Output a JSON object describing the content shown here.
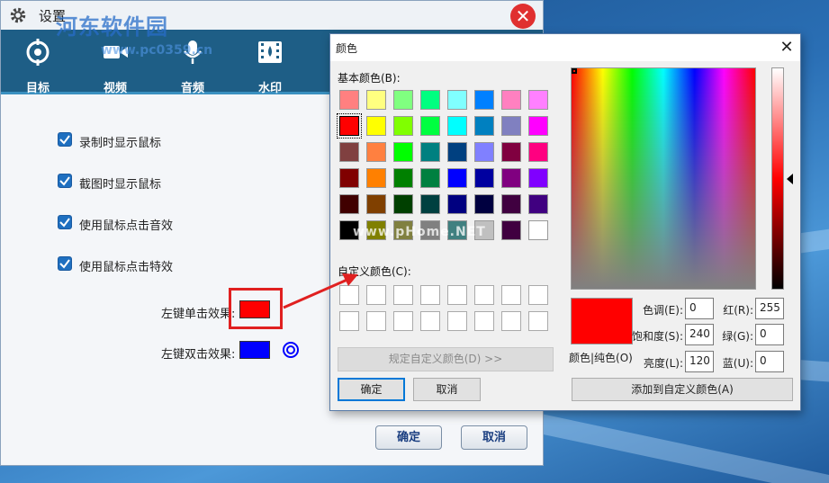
{
  "settings": {
    "title": "设置",
    "tabs": [
      {
        "label": "目标",
        "icon": "target-icon"
      },
      {
        "label": "视频",
        "icon": "video-camera-icon"
      },
      {
        "label": "音频",
        "icon": "microphone-icon"
      },
      {
        "label": "水印",
        "icon": "film-icon"
      }
    ],
    "checkboxes": [
      {
        "label": "录制时显示鼠标",
        "checked": true
      },
      {
        "label": "截图时显示鼠标",
        "checked": true
      },
      {
        "label": "使用鼠标点击音效",
        "checked": true
      },
      {
        "label": "使用鼠标点击特效",
        "checked": true
      }
    ],
    "left_single_label": "左键单击效果:",
    "left_double_label": "左键双击效果:",
    "single_color": "#ff0000",
    "double_color": "#0000ff",
    "ok_label": "确定",
    "cancel_label": "取消"
  },
  "watermark": {
    "line1": "河东软件园",
    "line2": "www.pc0359.cn",
    "line3": "www.pHome.NET"
  },
  "color_dialog": {
    "title": "颜色",
    "basic_colors_label": "基本颜色(B):",
    "custom_colors_label": "自定义颜色(C):",
    "define_custom_label": "规定自定义颜色(D) >>",
    "ok_label": "确定",
    "cancel_label": "取消",
    "add_custom_label": "添加到自定义颜色(A)",
    "preview_label": "颜色|纯色(O)",
    "fields": {
      "hue_label": "色调(E):",
      "hue": "0",
      "sat_label": "饱和度(S):",
      "sat": "240",
      "lum_label": "亮度(L):",
      "lum": "120",
      "red_label": "红(R):",
      "red": "255",
      "green_label": "绿(G):",
      "green": "0",
      "blue_label": "蓝(U):",
      "blue": "0"
    },
    "basic_colors": [
      [
        "#ff8080",
        "#ffff80",
        "#80ff80",
        "#00ff80",
        "#80ffff",
        "#0080ff",
        "#ff80c0",
        "#ff80ff"
      ],
      [
        "#ff0000",
        "#ffff00",
        "#80ff00",
        "#00ff40",
        "#00ffff",
        "#0080c0",
        "#8080c0",
        "#ff00ff"
      ],
      [
        "#804040",
        "#ff8040",
        "#00ff00",
        "#008080",
        "#004080",
        "#8080ff",
        "#800040",
        "#ff0080"
      ],
      [
        "#800000",
        "#ff8000",
        "#008000",
        "#008040",
        "#0000ff",
        "#0000a0",
        "#800080",
        "#8000ff"
      ],
      [
        "#400000",
        "#804000",
        "#004000",
        "#004040",
        "#000080",
        "#000040",
        "#400040",
        "#400080"
      ],
      [
        "#000000",
        "#808000",
        "#808040",
        "#808080",
        "#408080",
        "#c0c0c0",
        "#400040",
        "#ffffff"
      ]
    ],
    "selected_basic": "#ff0000",
    "preview_color": "#ff0000"
  }
}
